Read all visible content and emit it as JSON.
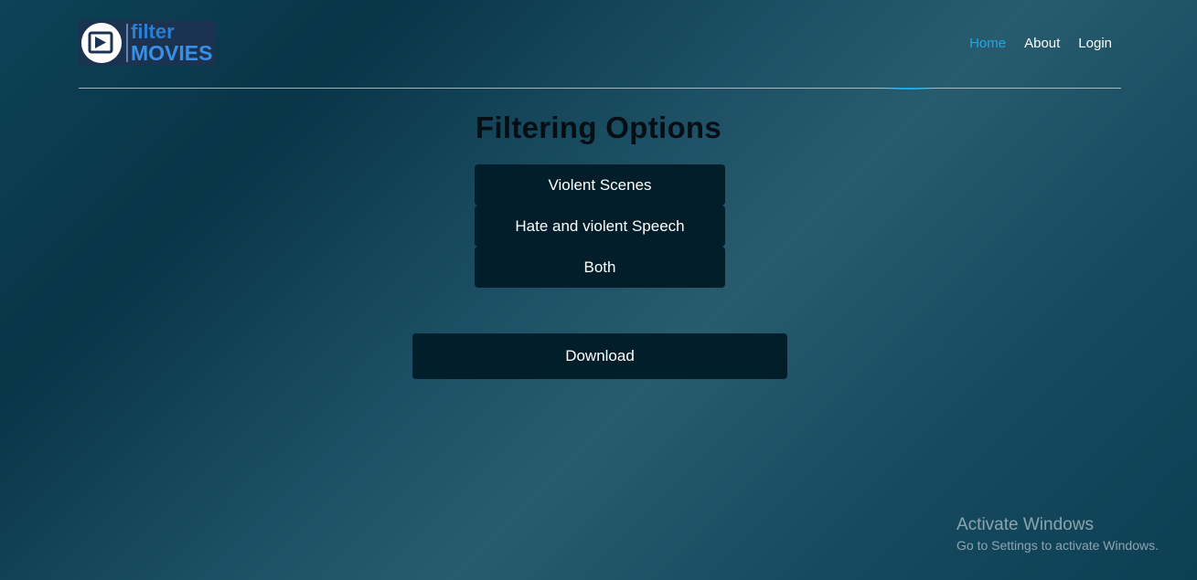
{
  "logo": {
    "line1": "filter",
    "line2": "MOVIES",
    "icon": "play-icon"
  },
  "nav": {
    "items": [
      {
        "label": "Home",
        "active": true
      },
      {
        "label": "About",
        "active": false
      },
      {
        "label": "Login",
        "active": false
      }
    ]
  },
  "main": {
    "title": "Filtering Options",
    "options": [
      "Violent Scenes",
      "Hate and violent Speech",
      "Both"
    ],
    "download_label": "Download"
  },
  "watermark": {
    "title": "Activate Windows",
    "subtitle": "Go to Settings to activate Windows."
  },
  "colors": {
    "accent": "#1fa9e3",
    "button_bg": "#031e2b",
    "logo_blue": "#3a8fe6"
  }
}
